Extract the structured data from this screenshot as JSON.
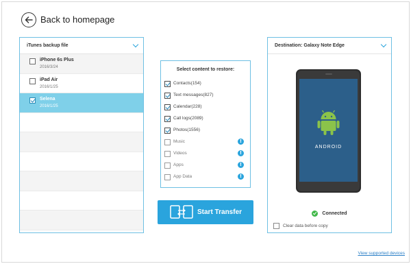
{
  "header": {
    "back_label": "Back to homepage",
    "back_icon": "arrow-left-icon"
  },
  "left_panel": {
    "title": "iTunes backup file",
    "dropdown_icon": "chevron-down-icon",
    "backups": [
      {
        "name": "iPhone 6s Plus",
        "date": "2016/3/24",
        "checked": false,
        "selected": false
      },
      {
        "name": "iPad Air",
        "date": "2016/1/25",
        "checked": false,
        "selected": false
      },
      {
        "name": "Selena",
        "date": "2016/1/25",
        "checked": true,
        "selected": true
      }
    ],
    "empty_rows": 7
  },
  "middle_panel": {
    "title": "Select content to restore:",
    "items": [
      {
        "label": "Contacts(154)",
        "checked": true,
        "info": false
      },
      {
        "label": "Text messages(827)",
        "checked": true,
        "info": false
      },
      {
        "label": "Calendar(228)",
        "checked": true,
        "info": false
      },
      {
        "label": "Call logs(2089)",
        "checked": true,
        "info": false
      },
      {
        "label": "Photos(1556)",
        "checked": true,
        "info": false
      },
      {
        "label": "Music",
        "checked": false,
        "info": true
      },
      {
        "label": "Videos",
        "checked": false,
        "info": true
      },
      {
        "label": "Apps",
        "checked": false,
        "info": true
      },
      {
        "label": "App Data",
        "checked": false,
        "info": true
      }
    ],
    "info_glyph": "!"
  },
  "start_button": {
    "label": "Start Transfer",
    "icon": "transfer-devices-icon"
  },
  "right_panel": {
    "title": "Destination: Galaxy Note Edge",
    "dropdown_icon": "chevron-down-icon",
    "phone_brand_text": "ANDROID",
    "status_label": "Connected",
    "status_icon": "check-circle-icon",
    "clear_data_label": "Clear data before copy",
    "clear_data_checked": false
  },
  "footer": {
    "link_label": "View supported devices"
  },
  "colors": {
    "accent": "#2aa4dd",
    "panel_border": "#6dbfe3",
    "selected_row": "#7fd0e9",
    "connected_green": "#41b84a",
    "android_green": "#8bc34a",
    "phone_screen": "#2c5f8a"
  }
}
